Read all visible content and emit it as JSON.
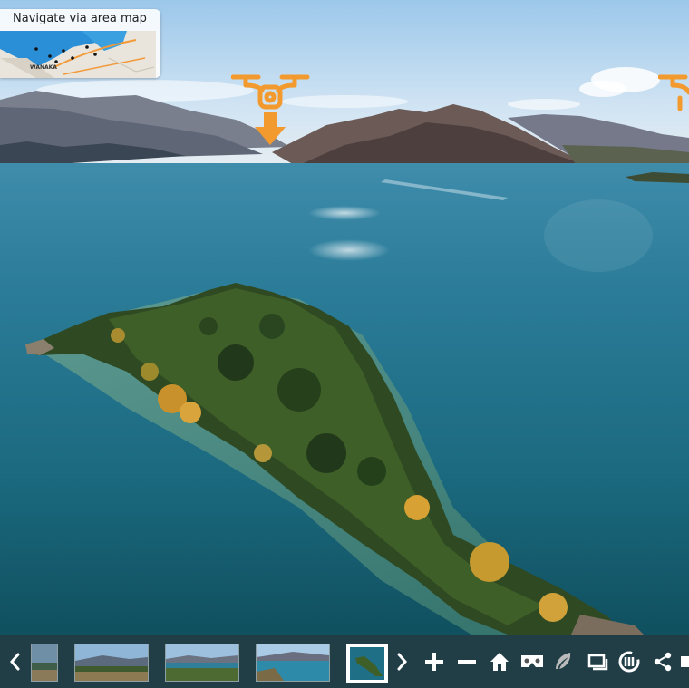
{
  "map": {
    "title": "Navigate via area map",
    "place_label": "WANAKA"
  },
  "hotspots": [
    {
      "icon": "drone-icon",
      "direction": "down"
    },
    {
      "icon": "drone-icon",
      "direction": "down"
    }
  ],
  "toolbar": {
    "thumbnails": [
      {
        "name": "thumbnail-1",
        "active": false
      },
      {
        "name": "thumbnail-2",
        "active": false
      },
      {
        "name": "thumbnail-3",
        "active": false
      },
      {
        "name": "thumbnail-4",
        "active": false
      },
      {
        "name": "thumbnail-5",
        "active": true
      }
    ],
    "icons": [
      "chevron-left-icon",
      "chevron-right-icon",
      "zoom-in-icon",
      "zoom-out-icon",
      "home-icon",
      "vr-headset-icon",
      "feather-icon",
      "fullscreen-icon",
      "autorotate-icon",
      "share-icon"
    ]
  },
  "colors": {
    "accent": "#f39a2e",
    "toolbar_bg": "#282828",
    "water": "#1f6f86"
  }
}
